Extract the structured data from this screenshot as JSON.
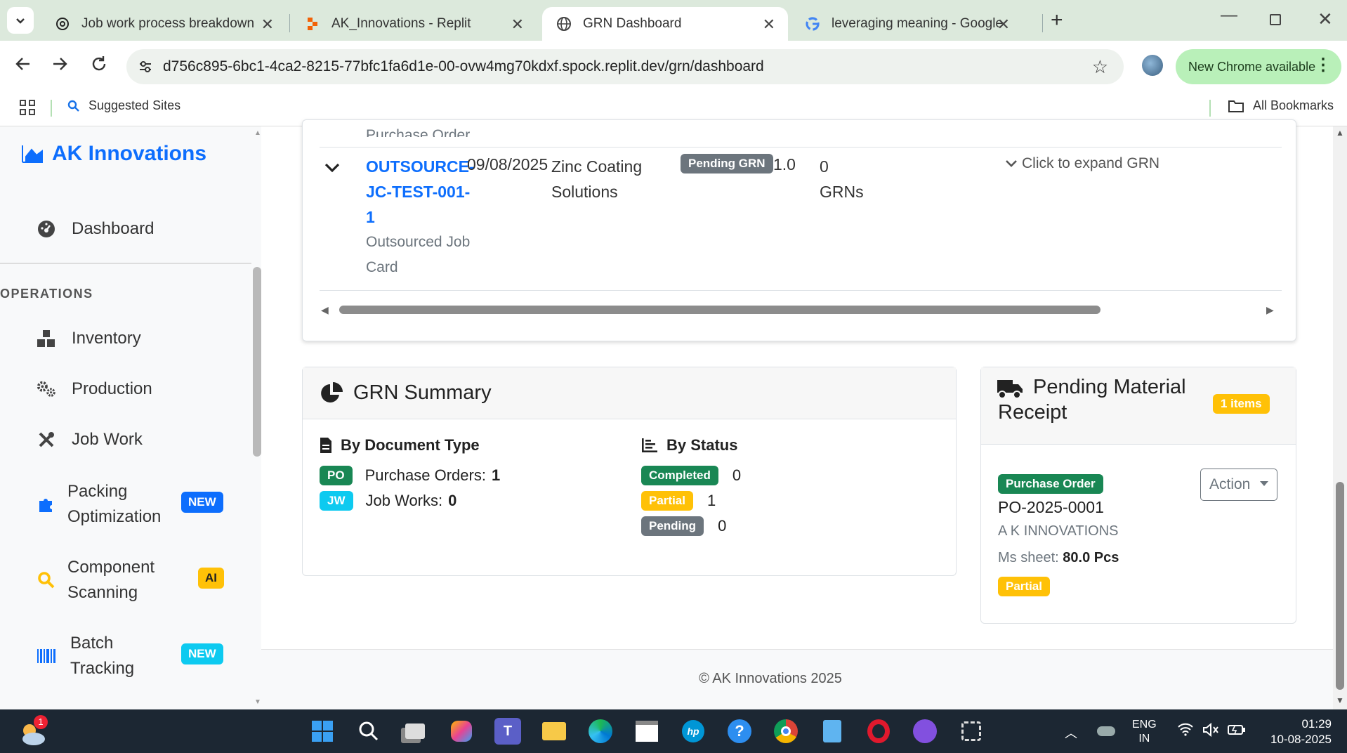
{
  "browser": {
    "tabs": [
      {
        "title": "Job work process breakdown"
      },
      {
        "title": "AK_Innovations - Replit"
      },
      {
        "title": "GRN Dashboard"
      },
      {
        "title": "leveraging meaning - Google S"
      }
    ],
    "url": "d756c895-6bc1-4ca2-8215-77bfc1fa6d1e-00-ovw4mg70kdxf.spock.replit.dev/grn/dashboard",
    "update_label": "New Chrome available",
    "bookmarks": {
      "suggested": "Suggested Sites",
      "all": "All Bookmarks"
    }
  },
  "sidebar": {
    "brand": "AK Innovations",
    "dashboard": "Dashboard",
    "section": "OPERATIONS",
    "items": [
      {
        "label": "Inventory"
      },
      {
        "label": "Production"
      },
      {
        "label": "Job Work"
      },
      {
        "label": "Packing Optimization",
        "line1": "Packing",
        "line2": "Optimization",
        "badge": "NEW"
      },
      {
        "label": "Component Scanning",
        "line1": "Component",
        "line2": "Scanning",
        "badge": "AI"
      },
      {
        "label": "Batch Tracking",
        "line1": "Batch",
        "line2": "Tracking",
        "badge": "NEW"
      }
    ]
  },
  "table": {
    "prev_row_text": "Purchase Order",
    "row": {
      "doc_line1": "OUTSOURCE-",
      "doc_line2": "JC-TEST-001-",
      "doc_line3": "1",
      "doc_type_line1": "Outsourced Job",
      "doc_type_line2": "Card",
      "date": "09/08/2025",
      "vendor_line1": "Zinc Coating",
      "vendor_line2": "Solutions",
      "status": "Pending GRN",
      "qty": "1.0",
      "grn_count": "0",
      "grn_label": "GRNs",
      "expand": "Click to expand GRN"
    }
  },
  "grn_summary": {
    "title": "GRN Summary",
    "by_doc_title": "By Document Type",
    "po_badge": "PO",
    "po_label": "Purchase Orders:",
    "po_count": "1",
    "jw_badge": "JW",
    "jw_label": "Job Works:",
    "jw_count": "0",
    "by_status_title": "By Status",
    "statuses": [
      {
        "label": "Completed",
        "count": "0",
        "color": "#198754"
      },
      {
        "label": "Partial",
        "count": "1",
        "color": "#ffc107"
      },
      {
        "label": "Pending",
        "count": "0",
        "color": "#6c757d"
      }
    ]
  },
  "pending": {
    "title_line1": "Pending Material",
    "title_line2": "Receipt",
    "count_badge": "1 items",
    "item": {
      "type": "Purchase Order",
      "number": "PO-2025-0001",
      "company": "A K INNOVATIONS",
      "material_label": "Ms sheet:",
      "material_qty": "80.0 Pcs",
      "status": "Partial",
      "action": "Action"
    }
  },
  "footer": "© AK Innovations 2025",
  "taskbar": {
    "weather_badge": "1",
    "lang_line1": "ENG",
    "lang_line2": "IN",
    "time": "01:29",
    "date": "10-08-2025"
  }
}
